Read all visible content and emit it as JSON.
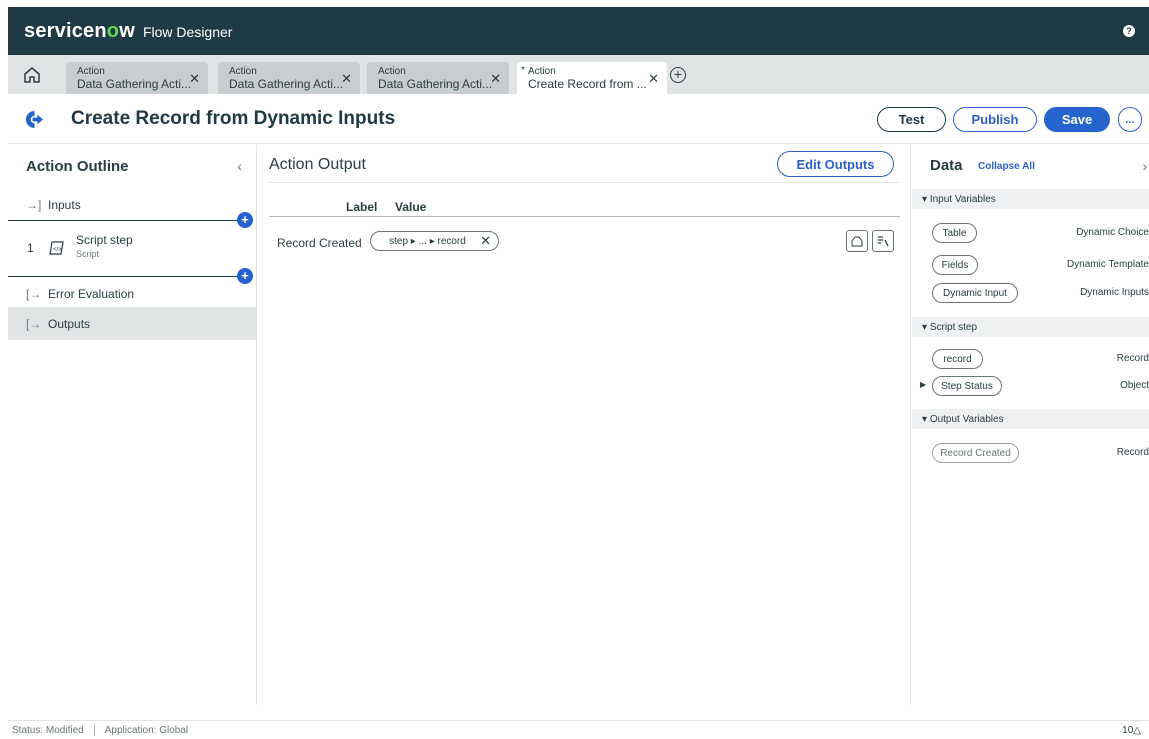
{
  "app": {
    "brand": "servicenow",
    "product": "Flow Designer",
    "help_icon": "question-icon"
  },
  "tabs": [
    {
      "kind": "Action",
      "title": "Data Gathering Acti...",
      "modified": false
    },
    {
      "kind": "Action",
      "title": "Data Gathering Acti...",
      "modified": false
    },
    {
      "kind": "Action",
      "title": "Data Gathering Acti...",
      "modified": false
    },
    {
      "kind": "Action",
      "title": "Create Record from ...",
      "modified": true,
      "modified_marker": "*"
    }
  ],
  "header": {
    "title": "Create Record from Dynamic Inputs",
    "test_label": "Test",
    "publish_label": "Publish",
    "save_label": "Save",
    "more_label": "..."
  },
  "outline": {
    "title": "Action Outline",
    "items": [
      {
        "label": "Inputs"
      },
      {
        "number": "1",
        "label": "Script step",
        "sub": "Script"
      },
      {
        "label": "Error Evaluation"
      },
      {
        "label": "Outputs",
        "selected": true
      }
    ]
  },
  "output": {
    "title": "Action Output",
    "edit_label": "Edit Outputs",
    "col_label": "Label",
    "col_value": "Value",
    "rows": [
      {
        "label": "Record Created",
        "value": "step ▸ ... ▸ record"
      }
    ]
  },
  "data_panel": {
    "title": "Data",
    "collapse_label": "Collapse All",
    "sections": [
      {
        "name": "Input Variables",
        "vars": [
          {
            "pill": "Table",
            "type": "Dynamic Choice"
          },
          {
            "pill": "Fields",
            "type": "Dynamic Template"
          },
          {
            "pill": "Dynamic Input",
            "type": "Dynamic Inputs"
          }
        ]
      },
      {
        "name": "Script step",
        "vars": [
          {
            "pill": "record",
            "type": "Record"
          },
          {
            "pill": "Step Status",
            "type": "Object"
          }
        ]
      },
      {
        "name": "Output Variables",
        "vars": [
          {
            "pill": "Record Created",
            "type": "Record"
          }
        ]
      }
    ]
  },
  "status": {
    "state": "Status: Modified",
    "application": "Application: Global",
    "right": "10△"
  },
  "colors": {
    "topbar": "#1f3a45",
    "accent": "#2563cf",
    "logo_o": "#62d84e"
  }
}
